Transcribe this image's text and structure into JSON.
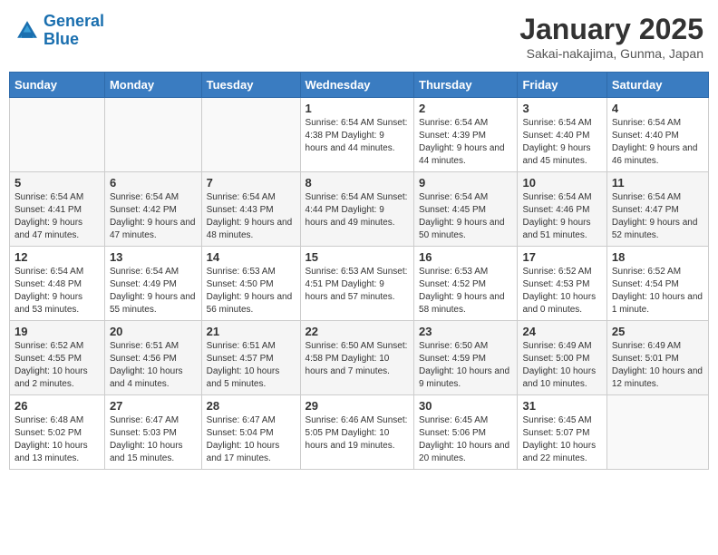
{
  "header": {
    "logo_line1": "General",
    "logo_line2": "Blue",
    "title": "January 2025",
    "subtitle": "Sakai-nakajima, Gunma, Japan"
  },
  "weekdays": [
    "Sunday",
    "Monday",
    "Tuesday",
    "Wednesday",
    "Thursday",
    "Friday",
    "Saturday"
  ],
  "weeks": [
    [
      {
        "day": "",
        "info": ""
      },
      {
        "day": "",
        "info": ""
      },
      {
        "day": "",
        "info": ""
      },
      {
        "day": "1",
        "info": "Sunrise: 6:54 AM\nSunset: 4:38 PM\nDaylight: 9 hours\nand 44 minutes."
      },
      {
        "day": "2",
        "info": "Sunrise: 6:54 AM\nSunset: 4:39 PM\nDaylight: 9 hours\nand 44 minutes."
      },
      {
        "day": "3",
        "info": "Sunrise: 6:54 AM\nSunset: 4:40 PM\nDaylight: 9 hours\nand 45 minutes."
      },
      {
        "day": "4",
        "info": "Sunrise: 6:54 AM\nSunset: 4:40 PM\nDaylight: 9 hours\nand 46 minutes."
      }
    ],
    [
      {
        "day": "5",
        "info": "Sunrise: 6:54 AM\nSunset: 4:41 PM\nDaylight: 9 hours\nand 47 minutes."
      },
      {
        "day": "6",
        "info": "Sunrise: 6:54 AM\nSunset: 4:42 PM\nDaylight: 9 hours\nand 47 minutes."
      },
      {
        "day": "7",
        "info": "Sunrise: 6:54 AM\nSunset: 4:43 PM\nDaylight: 9 hours\nand 48 minutes."
      },
      {
        "day": "8",
        "info": "Sunrise: 6:54 AM\nSunset: 4:44 PM\nDaylight: 9 hours\nand 49 minutes."
      },
      {
        "day": "9",
        "info": "Sunrise: 6:54 AM\nSunset: 4:45 PM\nDaylight: 9 hours\nand 50 minutes."
      },
      {
        "day": "10",
        "info": "Sunrise: 6:54 AM\nSunset: 4:46 PM\nDaylight: 9 hours\nand 51 minutes."
      },
      {
        "day": "11",
        "info": "Sunrise: 6:54 AM\nSunset: 4:47 PM\nDaylight: 9 hours\nand 52 minutes."
      }
    ],
    [
      {
        "day": "12",
        "info": "Sunrise: 6:54 AM\nSunset: 4:48 PM\nDaylight: 9 hours\nand 53 minutes."
      },
      {
        "day": "13",
        "info": "Sunrise: 6:54 AM\nSunset: 4:49 PM\nDaylight: 9 hours\nand 55 minutes."
      },
      {
        "day": "14",
        "info": "Sunrise: 6:53 AM\nSunset: 4:50 PM\nDaylight: 9 hours\nand 56 minutes."
      },
      {
        "day": "15",
        "info": "Sunrise: 6:53 AM\nSunset: 4:51 PM\nDaylight: 9 hours\nand 57 minutes."
      },
      {
        "day": "16",
        "info": "Sunrise: 6:53 AM\nSunset: 4:52 PM\nDaylight: 9 hours\nand 58 minutes."
      },
      {
        "day": "17",
        "info": "Sunrise: 6:52 AM\nSunset: 4:53 PM\nDaylight: 10 hours\nand 0 minutes."
      },
      {
        "day": "18",
        "info": "Sunrise: 6:52 AM\nSunset: 4:54 PM\nDaylight: 10 hours\nand 1 minute."
      }
    ],
    [
      {
        "day": "19",
        "info": "Sunrise: 6:52 AM\nSunset: 4:55 PM\nDaylight: 10 hours\nand 2 minutes."
      },
      {
        "day": "20",
        "info": "Sunrise: 6:51 AM\nSunset: 4:56 PM\nDaylight: 10 hours\nand 4 minutes."
      },
      {
        "day": "21",
        "info": "Sunrise: 6:51 AM\nSunset: 4:57 PM\nDaylight: 10 hours\nand 5 minutes."
      },
      {
        "day": "22",
        "info": "Sunrise: 6:50 AM\nSunset: 4:58 PM\nDaylight: 10 hours\nand 7 minutes."
      },
      {
        "day": "23",
        "info": "Sunrise: 6:50 AM\nSunset: 4:59 PM\nDaylight: 10 hours\nand 9 minutes."
      },
      {
        "day": "24",
        "info": "Sunrise: 6:49 AM\nSunset: 5:00 PM\nDaylight: 10 hours\nand 10 minutes."
      },
      {
        "day": "25",
        "info": "Sunrise: 6:49 AM\nSunset: 5:01 PM\nDaylight: 10 hours\nand 12 minutes."
      }
    ],
    [
      {
        "day": "26",
        "info": "Sunrise: 6:48 AM\nSunset: 5:02 PM\nDaylight: 10 hours\nand 13 minutes."
      },
      {
        "day": "27",
        "info": "Sunrise: 6:47 AM\nSunset: 5:03 PM\nDaylight: 10 hours\nand 15 minutes."
      },
      {
        "day": "28",
        "info": "Sunrise: 6:47 AM\nSunset: 5:04 PM\nDaylight: 10 hours\nand 17 minutes."
      },
      {
        "day": "29",
        "info": "Sunrise: 6:46 AM\nSunset: 5:05 PM\nDaylight: 10 hours\nand 19 minutes."
      },
      {
        "day": "30",
        "info": "Sunrise: 6:45 AM\nSunset: 5:06 PM\nDaylight: 10 hours\nand 20 minutes."
      },
      {
        "day": "31",
        "info": "Sunrise: 6:45 AM\nSunset: 5:07 PM\nDaylight: 10 hours\nand 22 minutes."
      },
      {
        "day": "",
        "info": ""
      }
    ]
  ]
}
